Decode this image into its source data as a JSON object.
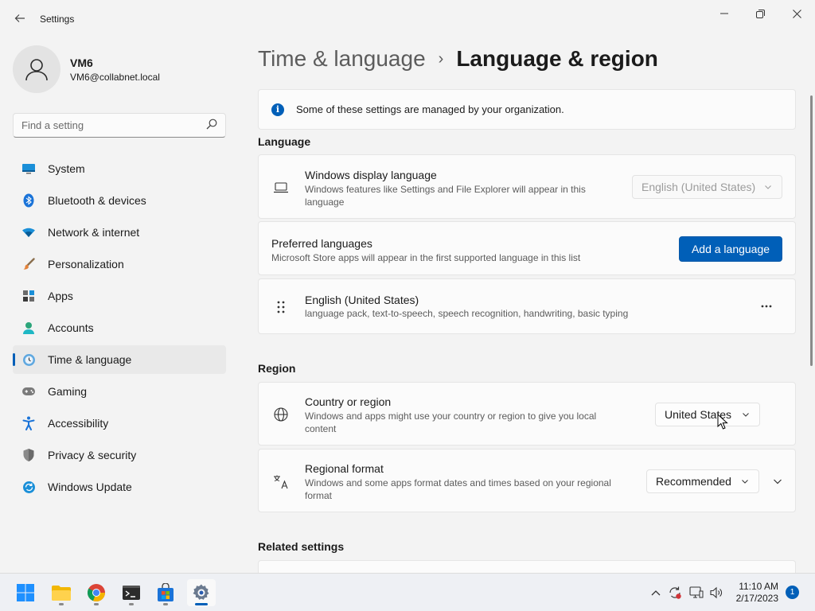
{
  "window": {
    "title": "Settings"
  },
  "profile": {
    "name": "VM6",
    "email": "VM6@collabnet.local"
  },
  "search": {
    "placeholder": "Find a setting"
  },
  "sidebar": {
    "items": [
      {
        "label": "System",
        "icon": "system-icon"
      },
      {
        "label": "Bluetooth & devices",
        "icon": "bluetooth-icon"
      },
      {
        "label": "Network & internet",
        "icon": "wifi-icon"
      },
      {
        "label": "Personalization",
        "icon": "brush-icon"
      },
      {
        "label": "Apps",
        "icon": "apps-icon"
      },
      {
        "label": "Accounts",
        "icon": "person-icon"
      },
      {
        "label": "Time & language",
        "icon": "clock-globe-icon",
        "active": true
      },
      {
        "label": "Gaming",
        "icon": "controller-icon"
      },
      {
        "label": "Accessibility",
        "icon": "accessibility-icon"
      },
      {
        "label": "Privacy & security",
        "icon": "shield-icon"
      },
      {
        "label": "Windows Update",
        "icon": "update-icon"
      }
    ]
  },
  "breadcrumb": {
    "parent": "Time & language",
    "separator": "›",
    "current": "Language & region"
  },
  "banner": {
    "text": "Some of these settings are managed by your organization."
  },
  "language": {
    "section_title": "Language",
    "display_language": {
      "title": "Windows display language",
      "description": "Windows features like Settings and File Explorer will appear in this language",
      "value": "English (United States)"
    },
    "preferred": {
      "title": "Preferred languages",
      "description": "Microsoft Store apps will appear in the first supported language in this list",
      "button": "Add a language"
    },
    "entry": {
      "title": "English (United States)",
      "description": "language pack, text-to-speech, speech recognition, handwriting, basic typing",
      "more": "..."
    }
  },
  "region": {
    "section_title": "Region",
    "country": {
      "title": "Country or region",
      "description": "Windows and apps might use your country or region to give you local content",
      "value": "United States"
    },
    "format": {
      "title": "Regional format",
      "description": "Windows and some apps format dates and times based on your regional format",
      "value": "Recommended"
    }
  },
  "related": {
    "section_title": "Related settings"
  },
  "taskbar": {
    "apps": [
      "start-icon",
      "file-explorer-icon",
      "chrome-icon",
      "terminal-icon",
      "store-icon",
      "settings-icon"
    ],
    "time": "11:10 AM",
    "date": "2/17/2023",
    "notification_count": "1"
  },
  "colors": {
    "accent": "#005fb8",
    "background": "#f3f3f3",
    "card": "#fbfbfb"
  }
}
